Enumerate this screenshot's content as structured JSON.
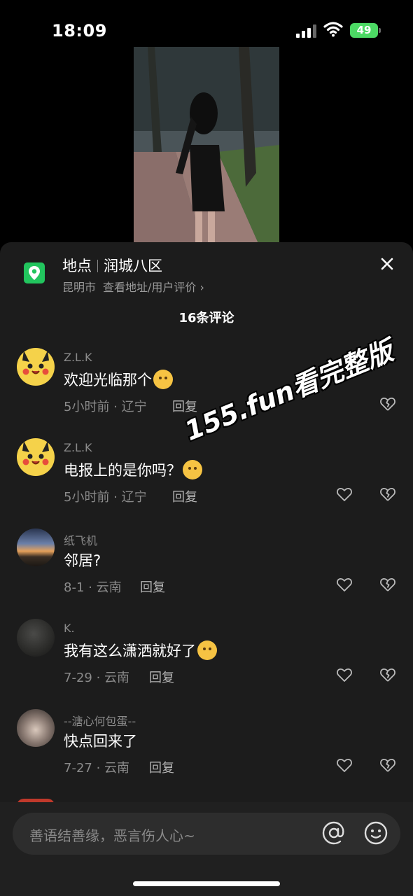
{
  "status_bar": {
    "time": "18:09",
    "battery": "49"
  },
  "location": {
    "label": "地点",
    "name": "润城八区",
    "city": "昆明市",
    "link": "查看地址/用户评价 ›"
  },
  "comments_header": {
    "count": "16条评论"
  },
  "comments": [
    {
      "user": "Z.L.K",
      "text": "欢迎光临那个",
      "time_region": "5小时前 · 辽宁",
      "reply": "回复"
    },
    {
      "user": "Z.L.K",
      "text": "电报上的是你吗？",
      "time_region": "5小时前 · 辽宁",
      "reply": "回复"
    },
    {
      "user": "纸飞机",
      "text": "邻居?",
      "time_region": "8-1 · 云南",
      "reply": "回复"
    },
    {
      "user": "K.",
      "text": "我有这么潇洒就好了",
      "time_region": "7-29 · 云南",
      "reply": "回复"
    },
    {
      "user": "--溏心何包蛋--",
      "text": "快点回来了",
      "time_region": "7-27 · 云南",
      "reply": "回复"
    }
  ],
  "watermark": "155.fun看完整版",
  "input": {
    "placeholder": "善语结善缘，恶言伤人心~"
  },
  "colors": {
    "sheet_bg": "#1c1c1c",
    "location_green": "#22c55e",
    "battery_green": "#4cd964"
  }
}
